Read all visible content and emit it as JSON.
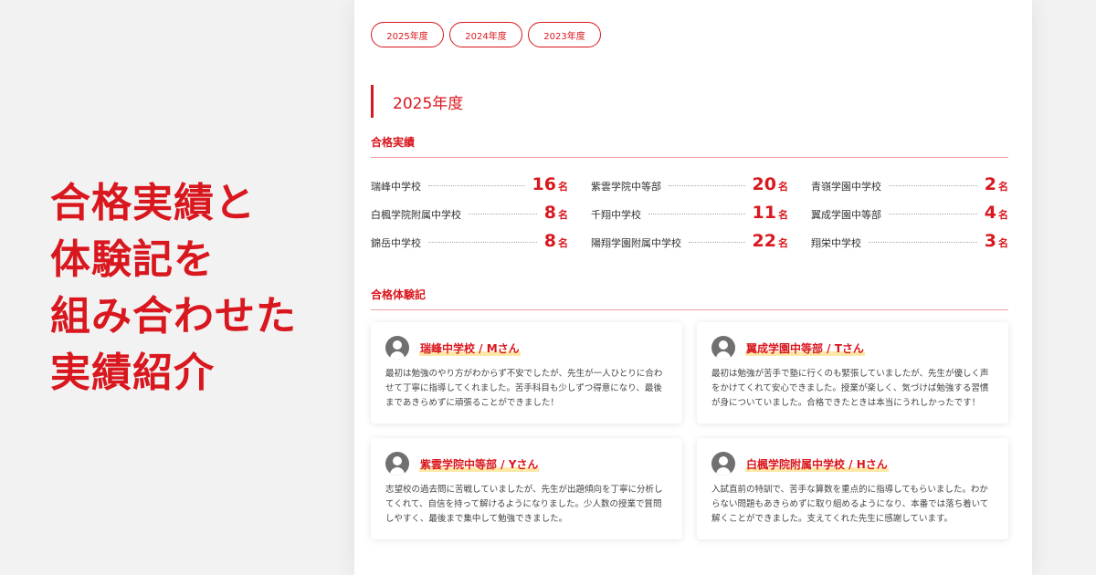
{
  "headline": [
    "合格実績と",
    "体験記を",
    "組み合わせた",
    "実績紹介"
  ],
  "year_tabs": [
    "2025年度",
    "2024年度",
    "2023年度"
  ],
  "section_title": "2025年度",
  "results_heading": "合格実績",
  "unit": "名",
  "results": [
    {
      "school": "瑞峰中学校",
      "count": "16"
    },
    {
      "school": "紫雲学院中等部",
      "count": "20"
    },
    {
      "school": "青嶺学園中学校",
      "count": "2"
    },
    {
      "school": "白楓学院附属中学校",
      "count": "8"
    },
    {
      "school": "千翔中学校",
      "count": "11"
    },
    {
      "school": "翼成学園中等部",
      "count": "4"
    },
    {
      "school": "錦岳中学校",
      "count": "8"
    },
    {
      "school": "陽翔学園附属中学校",
      "count": "22"
    },
    {
      "school": "翔栄中学校",
      "count": "3"
    }
  ],
  "stories_heading": "合格体験記",
  "stories": [
    {
      "title": "瑞峰中学校 / Mさん",
      "text": "最初は勉強のやり方がわからず不安でしたが、先生が一人ひとりに合わせて丁寧に指導してくれました。苦手科目も少しずつ得意になり、最後まであきらめずに頑張ることができました！"
    },
    {
      "title": "翼成学園中等部 / Tさん",
      "text": "最初は勉強が苦手で塾に行くのも緊張していましたが、先生が優しく声をかけてくれて安心できました。授業が楽しく、気づけば勉強する習慣が身についていました。合格できたときは本当にうれしかったです！"
    },
    {
      "title": "紫雲学院中等部 / Yさん",
      "text": "志望校の過去問に苦戦していましたが、先生が出題傾向を丁寧に分析してくれて、自信を持って解けるようになりました。少人数の授業で質問しやすく、最後まで集中して勉強できました。"
    },
    {
      "title": "白楓学院附属中学校 / Hさん",
      "text": "入試直前の特訓で、苦手な算数を重点的に指導してもらいました。わからない問題もあきらめずに取り組めるようになり、本番では落ち着いて解くことができました。支えてくれた先生に感謝しています。"
    }
  ],
  "colors": {
    "accent": "#d9171e",
    "highlight": "#fde8a8"
  },
  "icons": {
    "avatar": "user-avatar-icon"
  }
}
